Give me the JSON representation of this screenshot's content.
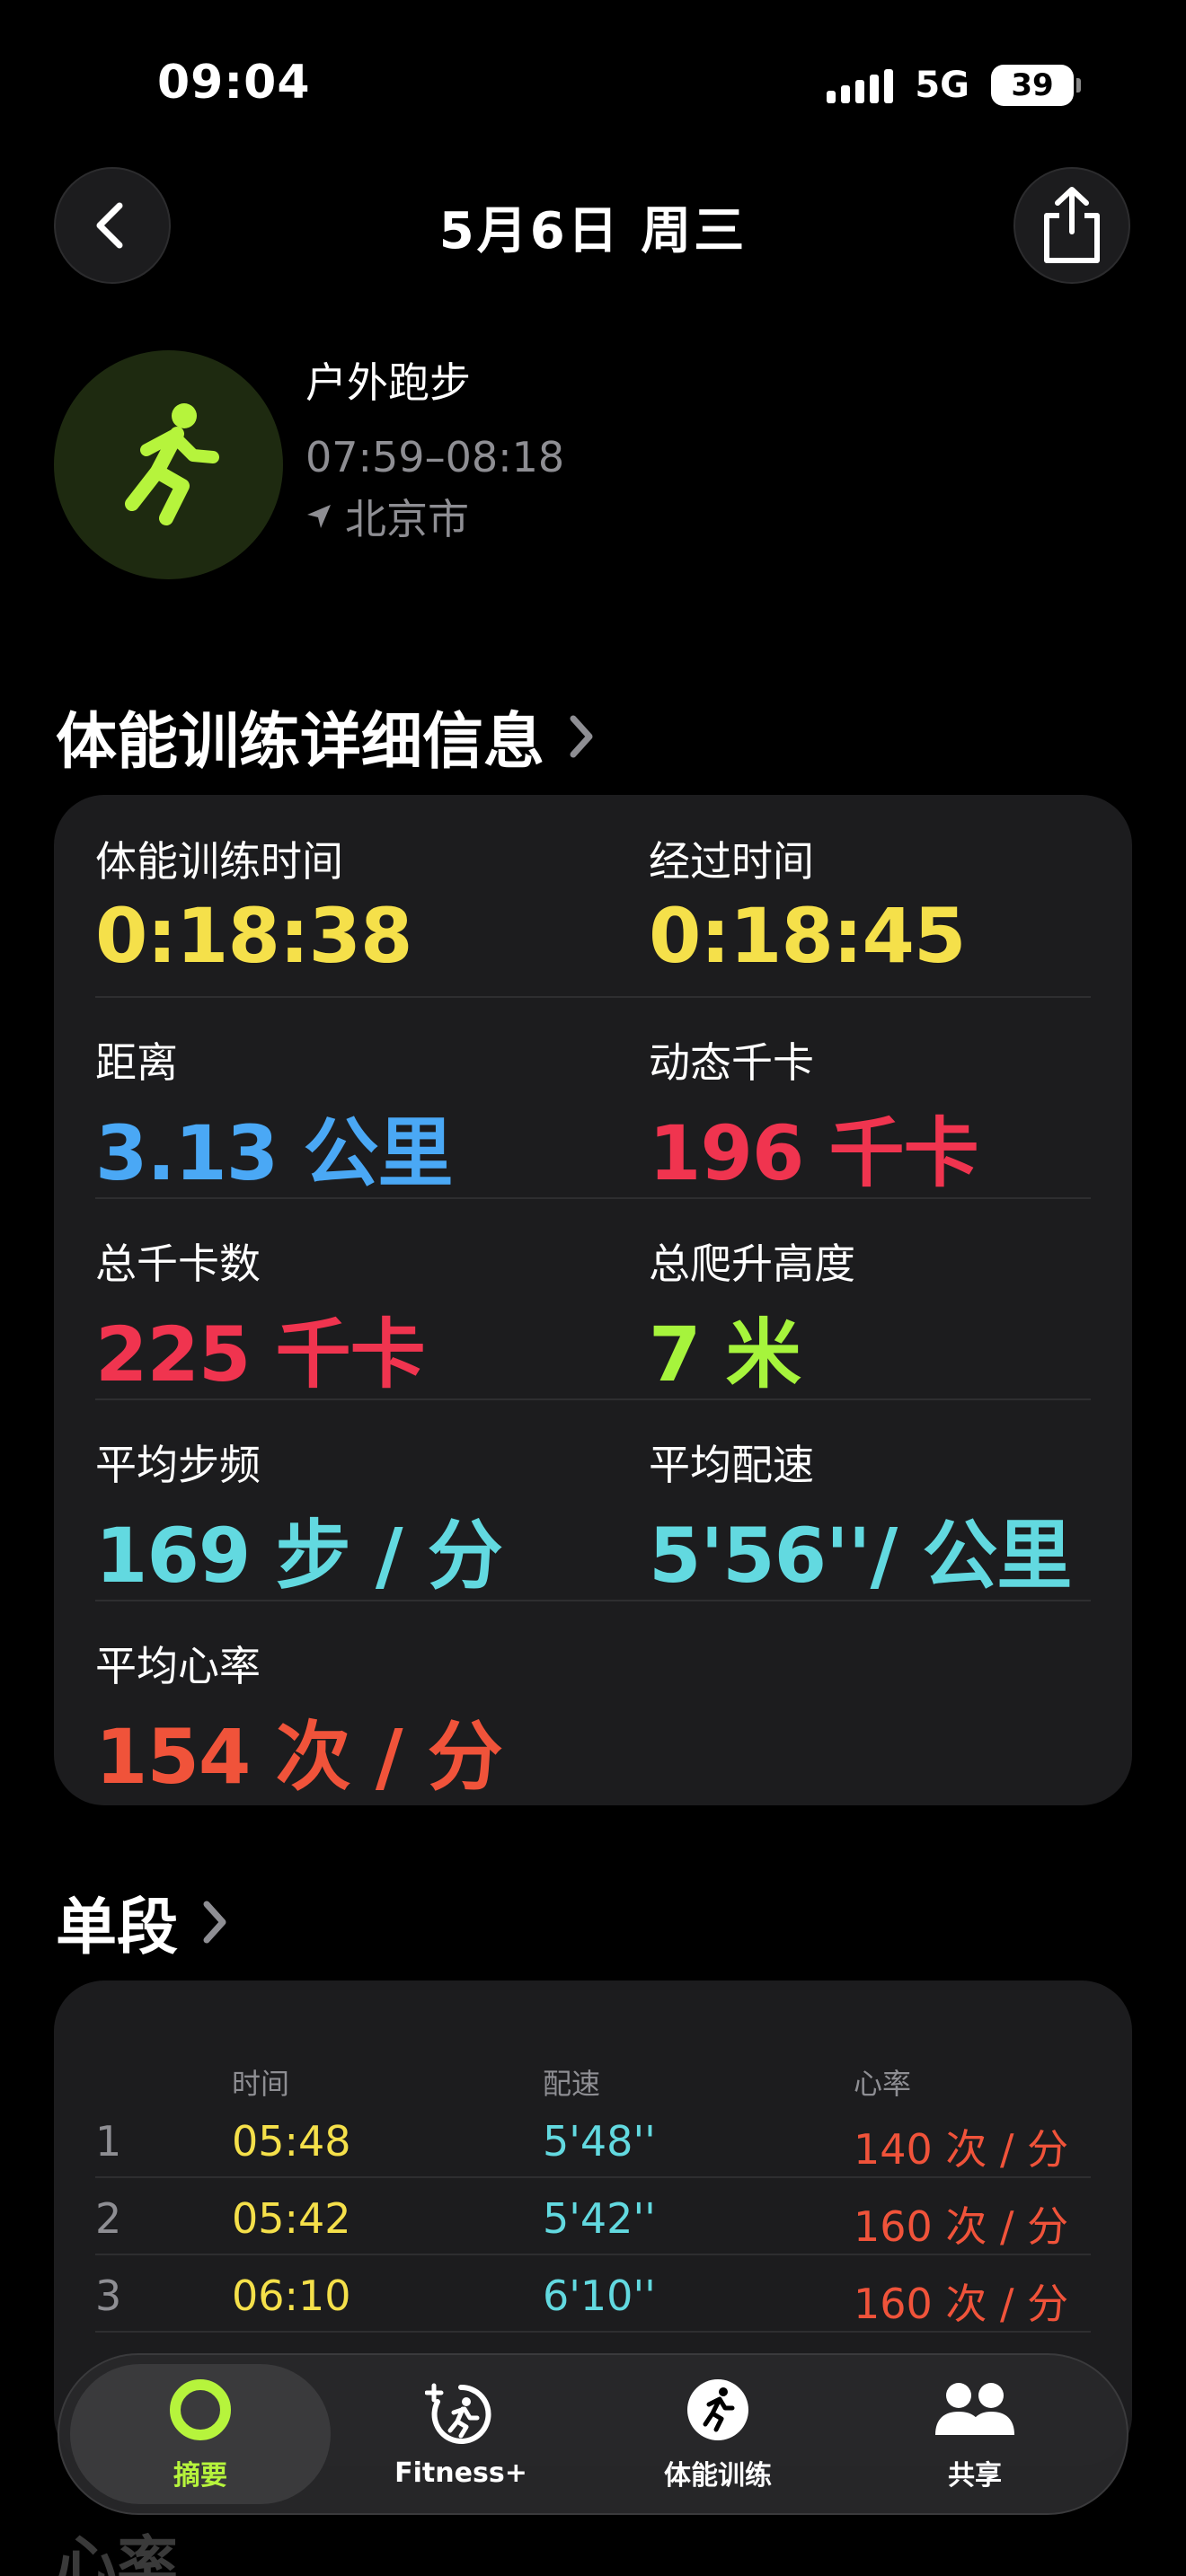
{
  "status": {
    "time": "09:04",
    "network": "5G",
    "battery": "39"
  },
  "nav": {
    "title": "5月6日 周三",
    "back_icon": "chevron-left-icon",
    "share_icon": "share-icon"
  },
  "workout": {
    "name": "户外跑步",
    "time_range": "07:59–08:18",
    "location": "北京市",
    "icon": "running-figure-icon",
    "accent": "#b6f43c"
  },
  "details": {
    "title": "体能训练详细信息",
    "metrics": [
      {
        "label": "体能训练时间",
        "value": "0:18:38",
        "color": "#f5e04a"
      },
      {
        "label": "经过时间",
        "value": "0:18:45",
        "color": "#f5e04a"
      },
      {
        "label": "距离",
        "value": "3.13 公里",
        "color": "#4aa8f5"
      },
      {
        "label": "动态千卡",
        "value": "196 千卡",
        "color": "#f0344f"
      },
      {
        "label": "总千卡数",
        "value": "225 千卡",
        "color": "#f0344f"
      },
      {
        "label": "总爬升高度",
        "value": "7 米",
        "color": "#a6f43c"
      },
      {
        "label": "平均步频",
        "value": "169 步 / 分",
        "color": "#62d9e0"
      },
      {
        "label": "平均配速",
        "value": "5'56''/ 公里",
        "color": "#62d9e0"
      },
      {
        "label": "平均心率",
        "value": "154 次 / 分",
        "color": "#f0533a"
      }
    ]
  },
  "splits": {
    "title": "单段",
    "headers": {
      "time": "时间",
      "pace": "配速",
      "heart_rate": "心率"
    },
    "rows": [
      {
        "index": "1",
        "time": "05:48",
        "pace": "5'48''",
        "hr": "140 次 / 分"
      },
      {
        "index": "2",
        "time": "05:42",
        "pace": "5'42''",
        "hr": "160 次 / 分"
      },
      {
        "index": "3",
        "time": "06:10",
        "pace": "6'10''",
        "hr": "160 次 / 分"
      }
    ]
  },
  "heart_section": {
    "title": "心率"
  },
  "tabs": [
    {
      "label": "摘要",
      "icon": "activity-ring-icon",
      "active": true
    },
    {
      "label": "Fitness+",
      "icon": "fitness-plus-icon",
      "active": false
    },
    {
      "label": "体能训练",
      "icon": "workout-runner-icon",
      "active": false
    },
    {
      "label": "共享",
      "icon": "sharing-people-icon",
      "active": false
    }
  ]
}
